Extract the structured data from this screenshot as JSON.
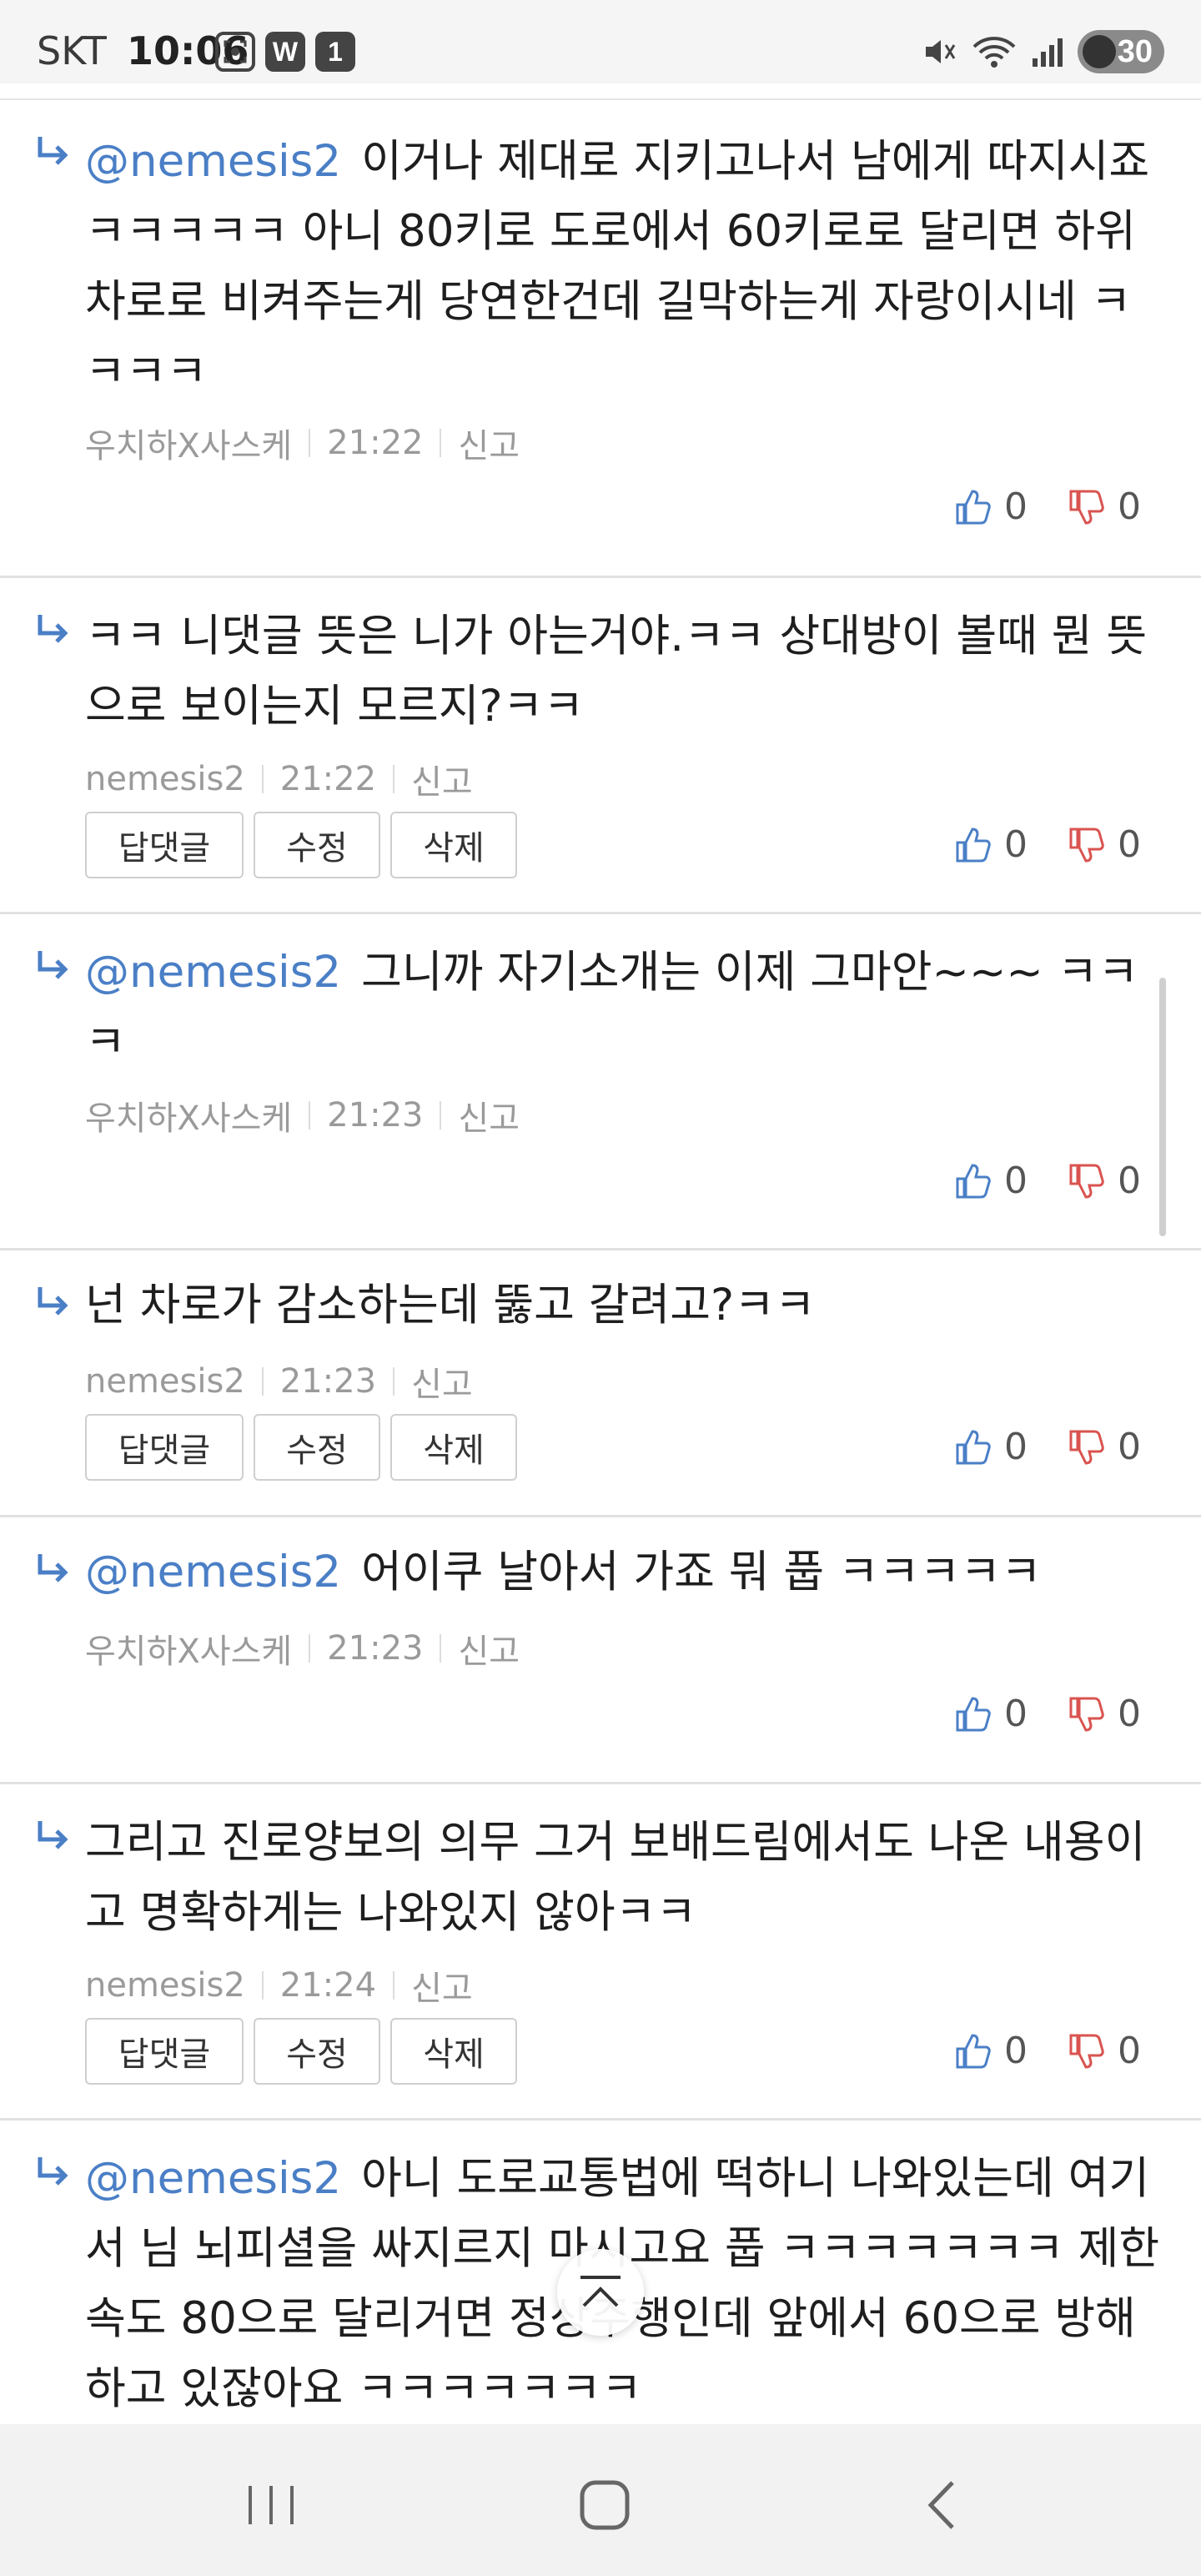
{
  "status_bar": {
    "carrier": "SKT",
    "time": "10:06",
    "app_icons": [
      "screenshot-icon",
      "w-app-icon",
      "notification-count-icon"
    ],
    "w_label": "W",
    "count_label": "1",
    "battery": "30"
  },
  "buttons": {
    "reply": "답댓글",
    "edit": "수정",
    "delete": "삭제"
  },
  "comments": [
    {
      "mention": "@nemesis2",
      "text": "이거나 제대로 지키고나서 남에게 따지시죠 ㅋㅋㅋㅋㅋ 아니 80키로 도로에서 60키로로 달리면 하위차로로 비켜주는게 당연한건데 길막하는게 자랑이시네 ㅋㅋㅋㅋ",
      "author": "우치하X사스케",
      "time": "21:22",
      "report": "신고",
      "likes": "0",
      "dislikes": "0",
      "owner_buttons": false
    },
    {
      "mention": "",
      "text": "ㅋㅋ 니댓글 뜻은 니가 아는거야.ㅋㅋ 상대방이 볼때 뭔 뜻으로 보이는지 모르지?ㅋㅋ",
      "author": "nemesis2",
      "time": "21:22",
      "report": "신고",
      "likes": "0",
      "dislikes": "0",
      "owner_buttons": true
    },
    {
      "mention": "@nemesis2",
      "text": "그니까 자기소개는 이제 그마안~~~ ㅋㅋㅋ",
      "author": "우치하X사스케",
      "time": "21:23",
      "report": "신고",
      "likes": "0",
      "dislikes": "0",
      "owner_buttons": false
    },
    {
      "mention": "",
      "text": "넌 차로가 감소하는데 뚫고 갈려고?ㅋㅋ",
      "author": "nemesis2",
      "time": "21:23",
      "report": "신고",
      "likes": "0",
      "dislikes": "0",
      "owner_buttons": true
    },
    {
      "mention": "@nemesis2",
      "text": "어이쿠 날아서 가죠 뭐 풉 ㅋㅋㅋㅋㅋ",
      "author": "우치하X사스케",
      "time": "21:23",
      "report": "신고",
      "likes": "0",
      "dislikes": "0",
      "owner_buttons": false
    },
    {
      "mention": "",
      "text": "그리고 진로양보의 의무 그거 보배드림에서도 나온 내용이고 명확하게는 나와있지 않아ㅋㅋ",
      "author": "nemesis2",
      "time": "21:24",
      "report": "신고",
      "likes": "0",
      "dislikes": "0",
      "owner_buttons": true
    },
    {
      "mention": "@nemesis2",
      "text": "아니 도로교통법에 떡하니 나와있는데 여기서 님 뇌피셜을 싸지르지 마시고요 풉 ㅋㅋㅋㅋㅋㅋㅋ 제한속도 80으로 달리거면 정상주행인데 앞에서 60으로 방해하고 있잖아요 ㅋㅋㅋㅋㅋㅋㅋ",
      "author": "",
      "time": "",
      "report": "",
      "likes": "",
      "dislikes": "",
      "owner_buttons": false
    }
  ],
  "colors": {
    "mention": "#4a7fc6",
    "like_icon": "#4a7fc6",
    "dislike_icon": "#d9534f",
    "reply_arrow": "#4a7fc6"
  },
  "nav": {
    "icons": [
      "recent-apps-icon",
      "home-icon",
      "back-icon"
    ]
  }
}
